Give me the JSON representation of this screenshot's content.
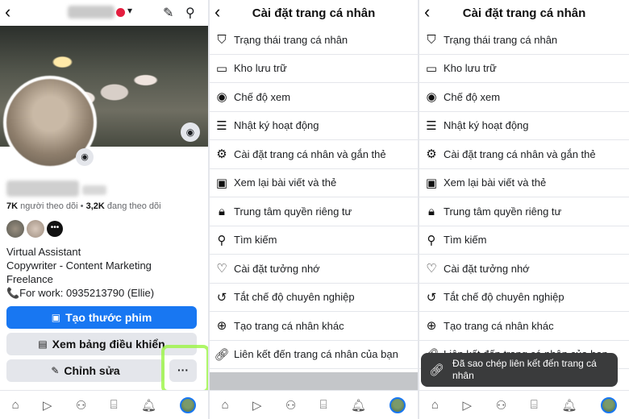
{
  "profile": {
    "name_blurred": "Thu Hằng",
    "followers": "7K",
    "followers_label": "người theo dõi",
    "following": "3,2K",
    "following_label": "đang theo dõi",
    "bio": [
      "Virtual Assistant",
      "Copywriter - Content Marketing",
      "Freelance",
      "📞For work: 0935213790 (Ellie)"
    ],
    "create_reel_label": "Tạo thước phim",
    "dashboard_label": "Xem bảng điều khiển",
    "edit_label": "Chỉnh sửa",
    "more_label": "···"
  },
  "settings": {
    "title": "Cài đặt trang cá nhân",
    "items": [
      {
        "icon": "shield-icon",
        "label": "Trạng thái trang cá nhân"
      },
      {
        "icon": "archive-icon",
        "label": "Kho lưu trữ"
      },
      {
        "icon": "eye-icon",
        "label": "Chế độ xem"
      },
      {
        "icon": "list-icon",
        "label": "Nhật ký hoạt động"
      },
      {
        "icon": "profile-settings-icon",
        "label": "Cài đặt trang cá nhân và gắn thẻ"
      },
      {
        "icon": "review-posts-icon",
        "label": "Xem lại bài viết và thẻ"
      },
      {
        "icon": "lock-icon",
        "label": "Trung tâm quyền riêng tư"
      },
      {
        "icon": "search-icon",
        "label": "Tìm kiếm"
      },
      {
        "icon": "heart-icon",
        "label": "Cài đặt tưởng nhớ"
      },
      {
        "icon": "undo-icon",
        "label": "Tắt chế độ chuyên nghiệp"
      },
      {
        "icon": "add-circle-icon",
        "label": "Tạo trang cá nhân khác"
      },
      {
        "icon": "link-icon",
        "label": "Liên kết đến trang cá nhân của bạn"
      }
    ]
  },
  "toast": {
    "text": "Đã sao chép liên kết đến trang cá nhân"
  },
  "nav": [
    "home-icon",
    "video-icon",
    "friends-icon",
    "marketplace-icon",
    "bell-icon",
    "profile-avatar"
  ],
  "colors": {
    "accent": "#1877f2",
    "highlight": "#9af542",
    "toast_bg": "#3a3b3c"
  }
}
